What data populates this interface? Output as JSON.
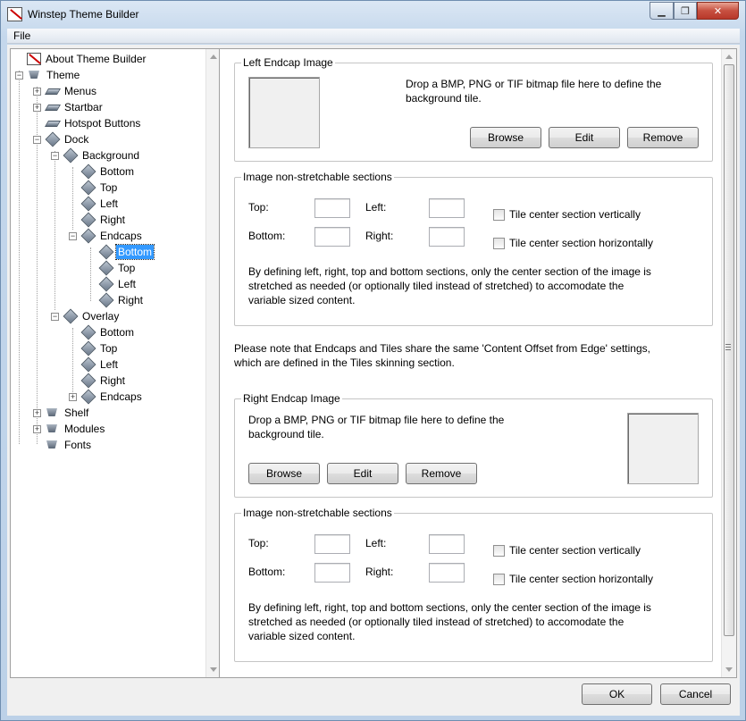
{
  "window": {
    "title": "Winstep Theme Builder"
  },
  "menu": {
    "file": "File"
  },
  "tree": {
    "about": "About Theme Builder",
    "theme": "Theme",
    "menus": "Menus",
    "startbar": "Startbar",
    "hotspot": "Hotspot Buttons",
    "dock": "Dock",
    "background": "Background",
    "bg_bottom": "Bottom",
    "bg_top": "Top",
    "bg_left": "Left",
    "bg_right": "Right",
    "endcaps": "Endcaps",
    "ec_bottom": "Bottom",
    "ec_top": "Top",
    "ec_left": "Left",
    "ec_right": "Right",
    "overlay": "Overlay",
    "ov_bottom": "Bottom",
    "ov_top": "Top",
    "ov_left": "Left",
    "ov_right": "Right",
    "ov_endcaps": "Endcaps",
    "shelf": "Shelf",
    "modules": "Modules",
    "fonts": "Fonts"
  },
  "left_endcap": {
    "title": "Left Endcap Image",
    "hint_line1": "Drop a BMP, PNG or TIF bitmap file here to define the",
    "hint_line2": "background tile.",
    "browse": "Browse",
    "edit": "Edit",
    "remove": "Remove"
  },
  "sections1": {
    "title": "Image non-stretchable sections",
    "top": "Top:",
    "left": "Left:",
    "bottom": "Bottom:",
    "right": "Right:",
    "tile_v": "Tile center section vertically",
    "tile_h": "Tile center section horizontally",
    "desc_line1": "By defining left, right, top and bottom sections, only the center section of the image is",
    "desc_line2": "stretched as needed (or optionally tiled instead of stretched) to accomodate the",
    "desc_line3": "variable sized content."
  },
  "note": {
    "line1": "Please note that Endcaps and Tiles share the same 'Content Offset from Edge' settings,",
    "line2": "which are defined in the Tiles skinning section."
  },
  "right_endcap": {
    "title": "Right Endcap Image",
    "hint_line1": "Drop a BMP, PNG or TIF bitmap file here to define the",
    "hint_line2": "background tile.",
    "browse": "Browse",
    "edit": "Edit",
    "remove": "Remove"
  },
  "sections2": {
    "title": "Image non-stretchable sections",
    "top": "Top:",
    "left": "Left:",
    "bottom": "Bottom:",
    "right": "Right:",
    "tile_v": "Tile center section vertically",
    "tile_h": "Tile center section horizontally",
    "desc_line1": "By defining left, right, top and bottom sections, only the center section of the image is",
    "desc_line2": "stretched as needed (or optionally tiled instead of stretched) to accomodate the",
    "desc_line3": "variable sized content."
  },
  "buttons": {
    "ok": "OK",
    "cancel": "Cancel"
  }
}
